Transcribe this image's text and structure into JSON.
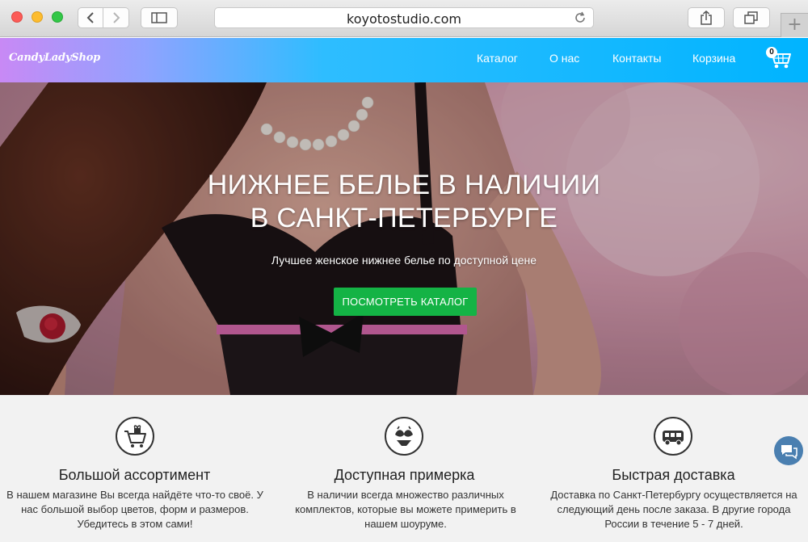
{
  "browser": {
    "url": "koyotostudio.com",
    "new_tab": "+"
  },
  "site": {
    "logo": "CandyLadyShop",
    "nav": [
      "Каталог",
      "О нас",
      "Контакты",
      "Корзина"
    ],
    "cart_count": "0"
  },
  "hero": {
    "title_line1": "НИЖНЕЕ БЕЛЬЕ В НАЛИЧИИ",
    "title_line2": "В САНКТ-ПЕТЕРБУРГЕ",
    "subtitle": "Лучшее женское нижнее белье по доступной цене",
    "cta": "ПОСМОТРЕТЬ КАТАЛОГ"
  },
  "features": [
    {
      "icon": "shopping-cart-gift-icon",
      "title": "Большой ассортимент",
      "text": "В нашем магазине Вы всегда найдёте что-то своё. У нас большой выбор цветов, форм и размеров. Убедитесь в этом сами!"
    },
    {
      "icon": "lingerie-icon",
      "title": "Доступная примерка",
      "text": "В наличии всегда множество различных комплектов, которые вы можете примерить в нашем шоуруме."
    },
    {
      "icon": "delivery-van-icon",
      "title": "Быстрая доставка",
      "text": "Доставка по Санкт-Петербургу осуществляется на следующий день после заказа. В другие города России в течение 5 - 7 дней."
    }
  ],
  "colors": {
    "header_gradient_start": "#c889f5",
    "header_gradient_end": "#00b4ff",
    "cta": "#14b345",
    "features_bg": "#f2f2f2",
    "chat": "#4a7fb0"
  }
}
